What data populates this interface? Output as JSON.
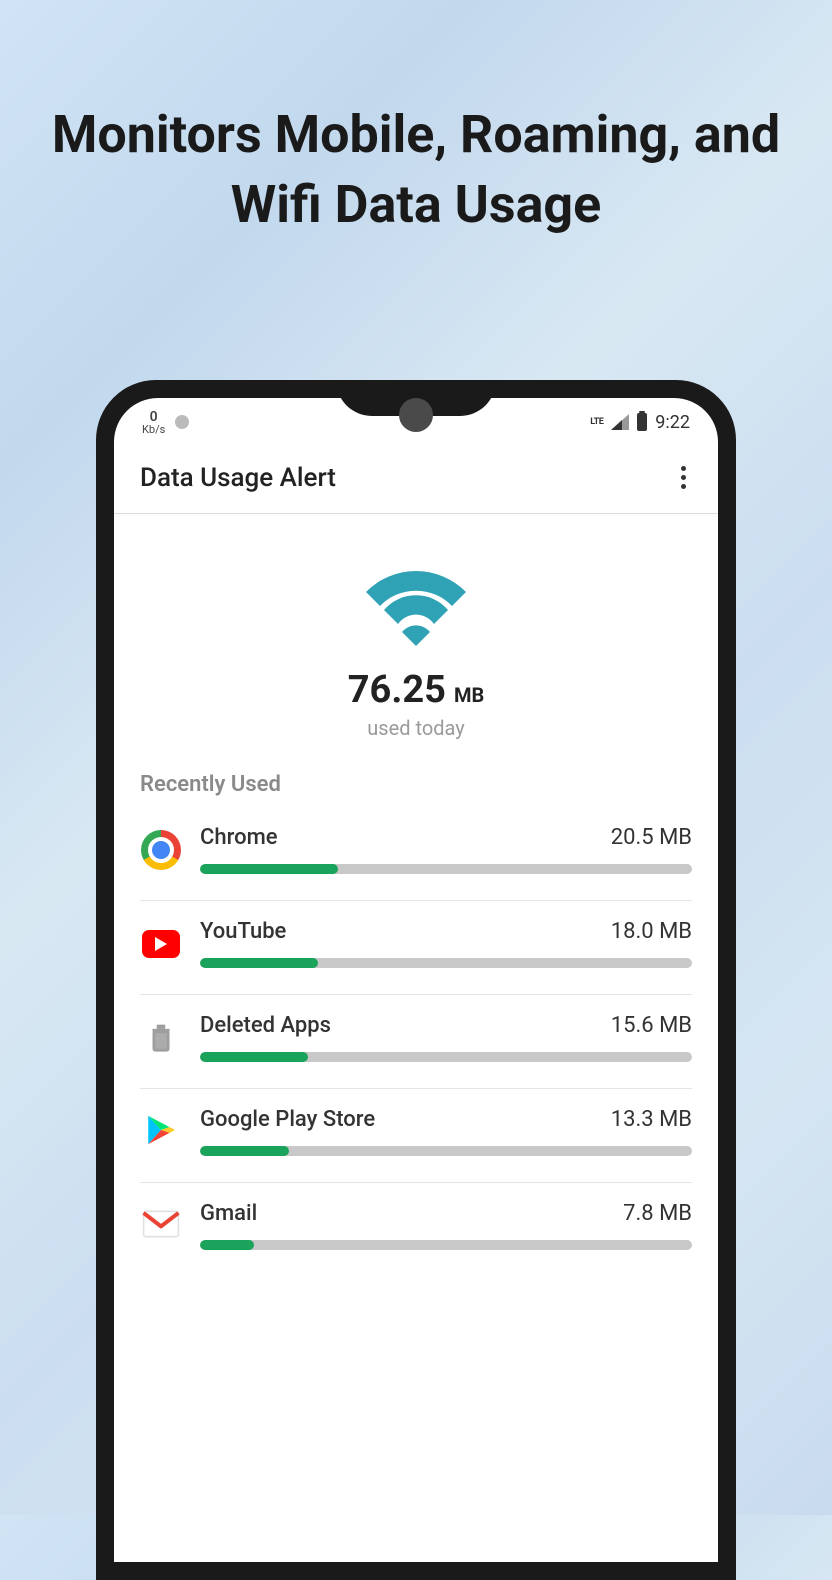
{
  "headline": "Monitors Mobile, Roaming, and Wifi Data Usage",
  "status": {
    "kbs_value": "0",
    "kbs_unit": "Kb/s",
    "network": "LTE",
    "time": "9:22"
  },
  "app_bar": {
    "title": "Data Usage Alert"
  },
  "summary": {
    "value": "76.25",
    "unit": "MB",
    "subtitle": "used today"
  },
  "section_title": "Recently Used",
  "apps": [
    {
      "name": "Chrome",
      "value": "20.5 MB",
      "pct": 28,
      "icon": "chrome"
    },
    {
      "name": "YouTube",
      "value": "18.0 MB",
      "pct": 24,
      "icon": "youtube"
    },
    {
      "name": "Deleted Apps",
      "value": "15.6 MB",
      "pct": 22,
      "icon": "trash"
    },
    {
      "name": "Google Play Store",
      "value": "13.3 MB",
      "pct": 18,
      "icon": "play"
    },
    {
      "name": "Gmail",
      "value": "7.8 MB",
      "pct": 11,
      "icon": "gmail"
    }
  ]
}
